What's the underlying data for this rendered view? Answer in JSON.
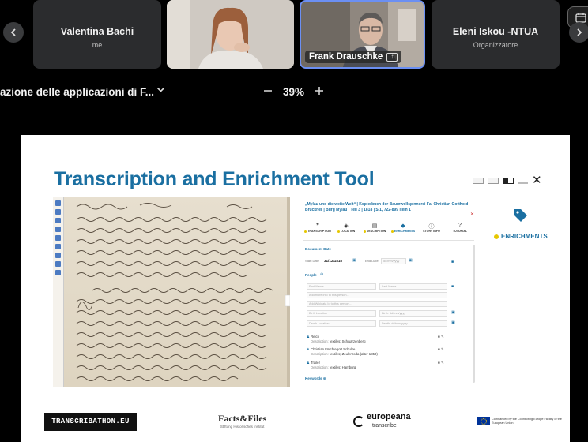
{
  "participants": [
    {
      "name": "Valentina Bachi",
      "role": "me"
    },
    {
      "name": "",
      "role": ""
    },
    {
      "name": "Frank Drauschke",
      "role": ""
    },
    {
      "name": "Eleni Iskou -NTUA",
      "role": "Organizzatore"
    }
  ],
  "icons": {
    "prev": "chevron-left-icon",
    "next": "chevron-right-icon",
    "calendar": "calendar-icon",
    "screen_share": "screen-share-icon",
    "dropdown": "chevron-down-icon",
    "zoom_out": "minus-icon",
    "zoom_in": "plus-icon",
    "tag": "tag-icon"
  },
  "share": {
    "title": "azione delle applicazioni di F...",
    "zoom": "39%"
  },
  "slide": {
    "title": "Transcription and Enrichment Tool",
    "document_title": "„Mylau und die weite Welt“ | Kopierbuch der Baumwollspinnerei Fa. Christian Gotthold Brückner | Burg Mylau | Teil 3 | 1818 | S.1, 722-899 Item 1",
    "tabs": [
      {
        "label": "TRANSCRIPTION",
        "icon": "quote-icon"
      },
      {
        "label": "LOCATION",
        "icon": "location-icon"
      },
      {
        "label": "DESCRIPTION",
        "icon": "description-icon"
      },
      {
        "label": "ENRICHMENTS",
        "icon": "tag-icon"
      },
      {
        "label": "STORY INFO",
        "icon": "info-icon"
      },
      {
        "label": "TUTORIAL",
        "icon": "help-icon"
      }
    ],
    "form": {
      "document_date": "Document Date",
      "start_date_label": "Start Date",
      "start_date": "31/12/1815",
      "end_date_label": "End Date",
      "end_date_placeholder": "dd/mm/yyyy",
      "people": "People",
      "first_name": "First Name",
      "last_name": "Last Name",
      "more_info": "Add more info to this person...",
      "wikidata": "Add Wikidata Id to this person...",
      "birth_location": "Birth Location",
      "birth_date": "Birth: dd/mm/yyyy",
      "death_location": "Death Location",
      "death_date": "Death: dd/mm/yyyy",
      "keywords": "Keywords"
    },
    "persons": [
      {
        "name": "Reich",
        "desc_label": "Description:",
        "desc": "textiles; Schwarzenberg"
      },
      {
        "name": "Christian Fürchtegott Schulze",
        "desc_label": "Description:",
        "desc": "textiles; Zeulenroda (after 1850)"
      },
      {
        "name": "Trailer",
        "desc_label": "Description:",
        "desc": "textiles; Hamburg"
      }
    ],
    "enrichments_label": "ENRICHMENTS",
    "footer": {
      "transcribathon": "TRANSCRIBATHON.EU",
      "factsfiles": "Facts&Files",
      "factsfiles_sub": "Stiftung Historisches Institut",
      "europeana": "europeana",
      "europeana_sub": "transcribe",
      "cef": "Co-financed by the Connecting Europe Facility of the European Union"
    }
  },
  "colors": {
    "accent_blue": "#1a6fa1",
    "highlight_yellow": "#e6c700",
    "active_speaker_border": "#6b8ff3"
  }
}
